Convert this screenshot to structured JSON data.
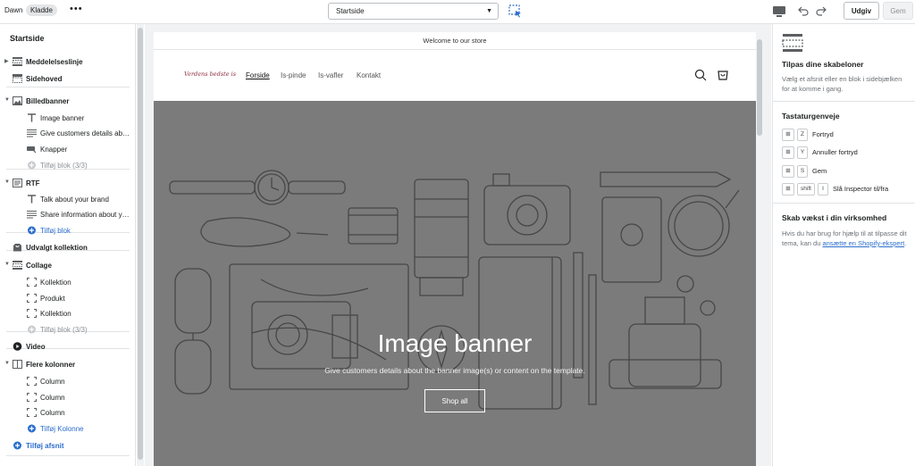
{
  "topbar": {
    "store_name": "Dawn",
    "status_badge": "Kladde",
    "more": "•••",
    "template_select": "Startside",
    "publish_label": "Udgiv",
    "save_label": "Gem"
  },
  "sidebar": {
    "title": "Startside",
    "items": [
      {
        "kind": "sec",
        "arrow": "▶",
        "icon": "section-icon",
        "label": "Meddelelseslinje"
      },
      {
        "kind": "sec",
        "arrow": "",
        "icon": "header-icon",
        "label": "Sidehoved"
      },
      {
        "kind": "sec",
        "arrow": "▼",
        "icon": "image-icon",
        "label": "Billedbanner"
      },
      {
        "kind": "blk",
        "icon": "text-icon",
        "label": "Image banner"
      },
      {
        "kind": "blk",
        "icon": "paragraph-icon",
        "label": "Give customers details abo..."
      },
      {
        "kind": "blk",
        "icon": "buttons-icon",
        "label": "Knapper"
      },
      {
        "kind": "dis",
        "icon": "add-icon",
        "label": "Tilføj blok (3/3)"
      },
      {
        "kind": "sec",
        "arrow": "▼",
        "icon": "richtext-icon",
        "label": "RTF"
      },
      {
        "kind": "blk",
        "icon": "text-icon",
        "label": "Talk about your brand"
      },
      {
        "kind": "blk",
        "icon": "paragraph-icon",
        "label": "Share information about yo..."
      },
      {
        "kind": "add",
        "icon": "add-icon",
        "label": "Tilføj blok"
      },
      {
        "kind": "sec",
        "arrow": "",
        "icon": "collection-icon",
        "label": "Udvalgt kollektion"
      },
      {
        "kind": "sec",
        "arrow": "▼",
        "icon": "collage-icon",
        "label": "Collage"
      },
      {
        "kind": "blk",
        "icon": "frame-icon",
        "label": "Kollektion"
      },
      {
        "kind": "blk",
        "icon": "frame-icon",
        "label": "Produkt"
      },
      {
        "kind": "blk",
        "icon": "frame-icon",
        "label": "Kollektion"
      },
      {
        "kind": "dis",
        "icon": "add-icon",
        "label": "Tilføj blok (3/3)"
      },
      {
        "kind": "sec",
        "arrow": "",
        "icon": "video-icon",
        "label": "Video"
      },
      {
        "kind": "sec",
        "arrow": "▼",
        "icon": "columns-icon",
        "label": "Flere kolonner"
      },
      {
        "kind": "blk",
        "icon": "frame-icon",
        "label": "Column"
      },
      {
        "kind": "blk",
        "icon": "frame-icon",
        "label": "Column"
      },
      {
        "kind": "blk",
        "icon": "frame-icon",
        "label": "Column"
      },
      {
        "kind": "add",
        "icon": "add-icon",
        "label": "Tilføj Kolonne"
      },
      {
        "kind": "addsec",
        "icon": "add-icon",
        "label": "Tilføj afsnit"
      }
    ]
  },
  "preview": {
    "announcement": "Welcome to our store",
    "logo_text": "Verdens bedste is",
    "nav": [
      "Forside",
      "Is-pinde",
      "Is-vafler",
      "Kontakt"
    ],
    "banner_title": "Image banner",
    "banner_text": "Give customers details about the banner image(s) or content on the template.",
    "banner_button": "Shop all"
  },
  "rpanel": {
    "title": "Tilpas dine skabeloner",
    "desc": "Vælg et afsnit eller en blok i sidebjælken for at komme i gang.",
    "shortcuts_title": "Tastaturgenveje",
    "shortcuts": [
      {
        "keys": [
          "⊞",
          "Z"
        ],
        "label": "Fortryd"
      },
      {
        "keys": [
          "⊞",
          "Y"
        ],
        "label": "Annuller fortryd"
      },
      {
        "keys": [
          "⊞",
          "S"
        ],
        "label": "Gem"
      },
      {
        "keys": [
          "⊞",
          "shift",
          "I"
        ],
        "label": "Slå Inspector til/fra"
      }
    ],
    "grow_title": "Skab vækst i din virksomhed",
    "grow_text": "Hvis du har brug for hjælp til at tilpasse dit tema, kan du ",
    "grow_link": "ansætte en Shopify-ekspert",
    "grow_end": "."
  },
  "colors": {
    "accent": "#2c6ecb",
    "banner_overlay": "#7b7b7b"
  }
}
